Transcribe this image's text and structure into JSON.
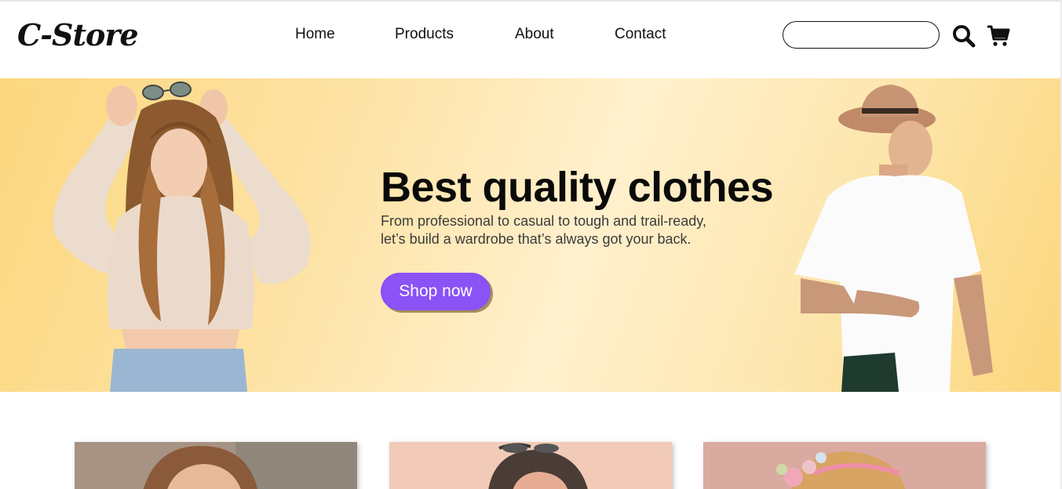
{
  "header": {
    "logo": "C-Store",
    "nav": [
      {
        "label": "Home"
      },
      {
        "label": "Products"
      },
      {
        "label": "About"
      },
      {
        "label": "Contact"
      }
    ],
    "search": {
      "placeholder": "",
      "value": "",
      "icon": "search-icon"
    },
    "cart": {
      "icon": "shopping-cart-icon"
    }
  },
  "hero": {
    "title": "Best quality clothes",
    "subtitle_line1": "From professional to casual to tough and trail-ready,",
    "subtitle_line2": "let’s build a wardrobe that’s always got your back.",
    "cta_label": "Shop now",
    "cta_color": "#8b52f6",
    "background_colors": [
      "#fcd77e",
      "#fff0cd"
    ]
  },
  "cards": [
    {
      "image": "woman-portrait-photo"
    },
    {
      "image": "woman-with-sunglasses-photo"
    },
    {
      "image": "girl-with-flower-headband-photo"
    }
  ]
}
